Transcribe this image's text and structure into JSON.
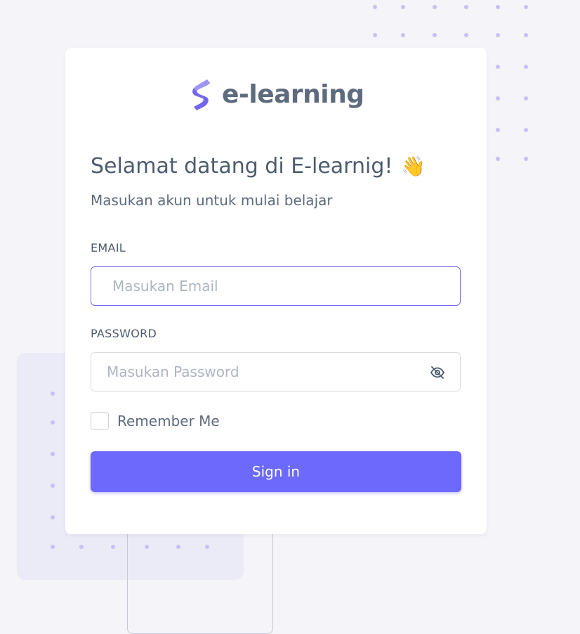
{
  "brand": {
    "name": "e-learning",
    "accent_color": "#6c69fc",
    "logo_icon": "logo-s-icon"
  },
  "header": {
    "title": "Selamat datang di E-learnig!",
    "wave_emoji": "👋",
    "subtitle": "Masukan akun untuk mulai belajar"
  },
  "form": {
    "email": {
      "label": "EMAIL",
      "placeholder": "Masukan Email",
      "value": ""
    },
    "password": {
      "label": "PASSWORD",
      "placeholder": "Masukan Password",
      "value": "",
      "toggle_icon": "eye-off-icon"
    },
    "remember": {
      "label": "Remember Me",
      "checked": false
    },
    "submit_label": "Sign in"
  }
}
